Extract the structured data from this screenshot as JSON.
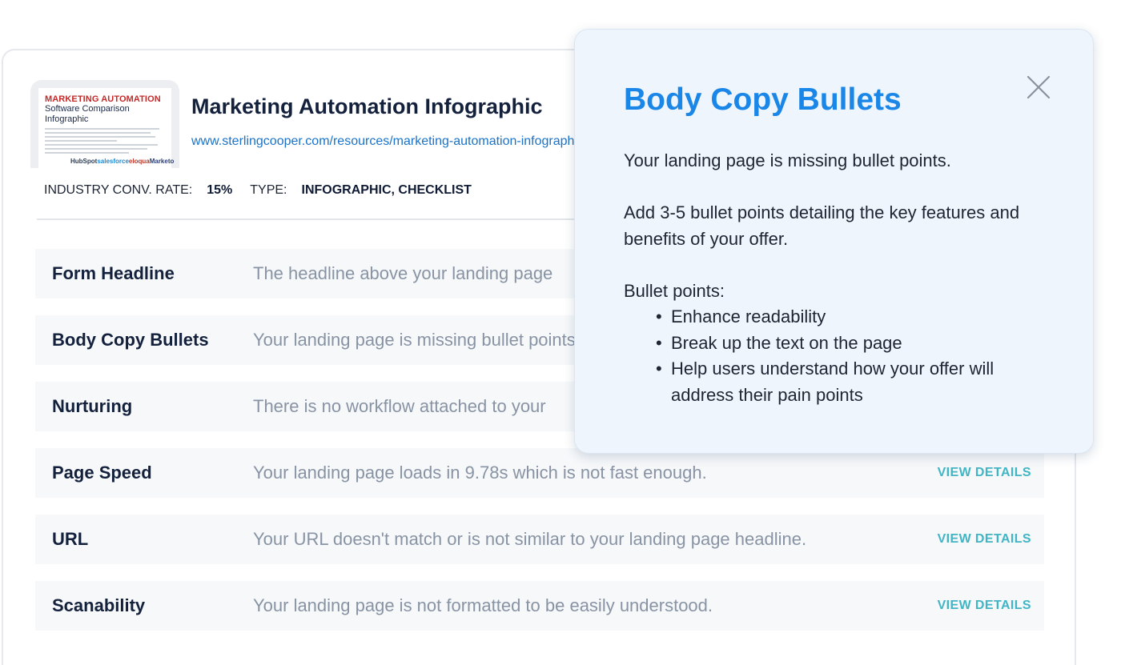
{
  "offer": {
    "thumbnail": {
      "title": "MARKETING AUTOMATION",
      "subtitle": "Software Comparison Infographic",
      "logos": [
        "HubSpot",
        "salesforce",
        "eloqua",
        "Marketo"
      ]
    },
    "title": "Marketing Automation Infographic",
    "url": "www.sterlingcooper.com/resources/marketing-automation-infographic",
    "meta": {
      "conv_rate_label": "INDUSTRY CONV. RATE:",
      "conv_rate_value": "15%",
      "type_label": "TYPE:",
      "type_value": "INFOGRAPHIC, CHECKLIST"
    }
  },
  "rows": [
    {
      "label": "Form Headline",
      "description": "The headline above your landing page",
      "action": ""
    },
    {
      "label": "Body Copy Bullets",
      "description": "Your landing page is missing bullet points.",
      "action": ""
    },
    {
      "label": "Nurturing",
      "description": "There is no workflow attached to your",
      "action": ""
    },
    {
      "label": "Page Speed",
      "description": "Your landing page loads in 9.78s which is not fast enough.",
      "action": "VIEW DETAILS"
    },
    {
      "label": "URL",
      "description": "Your URL doesn't match or is not similar to your landing page headline.",
      "action": "VIEW DETAILS"
    },
    {
      "label": "Scanability",
      "description": "Your landing page is not formatted to be easily understood.",
      "action": "VIEW DETAILS"
    }
  ],
  "popover": {
    "title": "Body Copy Bullets",
    "paragraph1": "Your landing page is missing bullet points.",
    "paragraph2": "Add 3-5 bullet points detailing the key features and benefits of your offer.",
    "bullets_intro": "Bullet points:",
    "bullets": [
      "Enhance readability",
      "Break up the text on the page",
      "Help users understand how your offer will address their pain points"
    ]
  },
  "colors": {
    "accent_blue": "#1a86e8",
    "link_blue": "#1a73c9",
    "action_teal": "#41b5c4",
    "thumbnail_red": "#c62828"
  },
  "icons": {
    "close": "close-icon"
  }
}
